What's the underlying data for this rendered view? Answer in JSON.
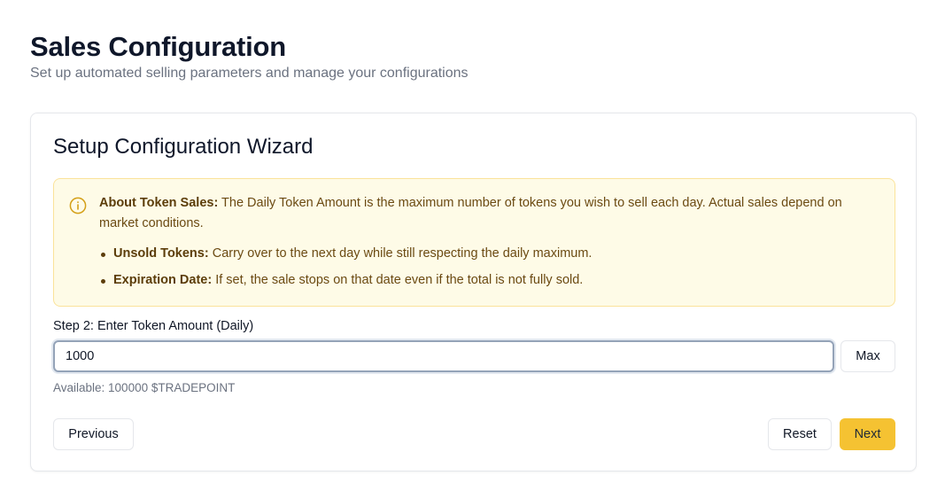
{
  "header": {
    "title": "Sales Configuration",
    "subtitle": "Set up automated selling parameters and manage your configurations"
  },
  "wizard": {
    "title": "Setup Configuration Wizard",
    "alert": {
      "icon": "info-circle-icon",
      "lead_bold": "About Token Sales:",
      "lead_text": " The Daily Token Amount is the maximum number of tokens you wish to sell each day. Actual sales depend on market conditions.",
      "items": [
        {
          "bold": "Unsold Tokens:",
          "text": " Carry over to the next day while still respecting the daily maximum."
        },
        {
          "bold": "Expiration Date:",
          "text": " If set, the sale stops on that date even if the total is not fully sold."
        }
      ],
      "colors": {
        "background": "#fefbe7",
        "border": "#fbe39a",
        "text": "#6b4a12",
        "icon": "#d4a017"
      }
    },
    "step_label": "Step 2: Enter Token Amount (Daily)",
    "amount_input": {
      "value": "1000",
      "placeholder": ""
    },
    "max_label": "Max",
    "available_text": "Available: 100000 $TRADEPOINT",
    "previous_label": "Previous",
    "reset_label": "Reset",
    "next_label": "Next",
    "accent_color": "#f5c232"
  }
}
